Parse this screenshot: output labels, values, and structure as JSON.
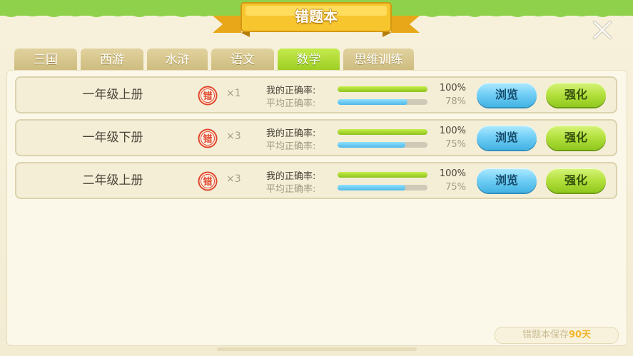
{
  "title": "错题本",
  "tabs": [
    {
      "label": "三国",
      "active": false
    },
    {
      "label": "西游",
      "active": false
    },
    {
      "label": "水浒",
      "active": false
    },
    {
      "label": "语文",
      "active": false
    },
    {
      "label": "数学",
      "active": true
    },
    {
      "label": "思维训练",
      "active": false
    }
  ],
  "rows": [
    {
      "name": "一年级上册",
      "error_icon_text": "错",
      "error_count": "×1",
      "my_accuracy_label": "我的正确率:",
      "my_accuracy": "100%",
      "my_accuracy_value": 1.0,
      "avg_accuracy_label": "平均正确率:",
      "avg_accuracy": "78%",
      "avg_accuracy_value": 0.78,
      "browse_label": "浏览",
      "strengthen_label": "强化"
    },
    {
      "name": "一年级下册",
      "error_icon_text": "错",
      "error_count": "×3",
      "my_accuracy_label": "我的正确率:",
      "my_accuracy": "100%",
      "my_accuracy_value": 1.0,
      "avg_accuracy_label": "平均正确率:",
      "avg_accuracy": "75%",
      "avg_accuracy_value": 0.75,
      "browse_label": "浏览",
      "strengthen_label": "强化"
    },
    {
      "name": "二年级上册",
      "error_icon_text": "错",
      "error_count": "×3",
      "my_accuracy_label": "我的正确率:",
      "my_accuracy": "100%",
      "my_accuracy_value": 1.0,
      "avg_accuracy_label": "平均正确率:",
      "avg_accuracy": "75%",
      "avg_accuracy_value": 0.75,
      "browse_label": "浏览",
      "strengthen_label": "强化"
    }
  ],
  "save_note": {
    "prefix": "错题本保存",
    "days": "90天"
  },
  "icons": {
    "close": "close-icon",
    "error_badge": "error-stamp-icon"
  },
  "colors": {
    "accent_green": "#9ccc22",
    "accent_blue": "#4fb9e8",
    "badge_red": "#e0472c",
    "gold": "#f1b62d"
  }
}
